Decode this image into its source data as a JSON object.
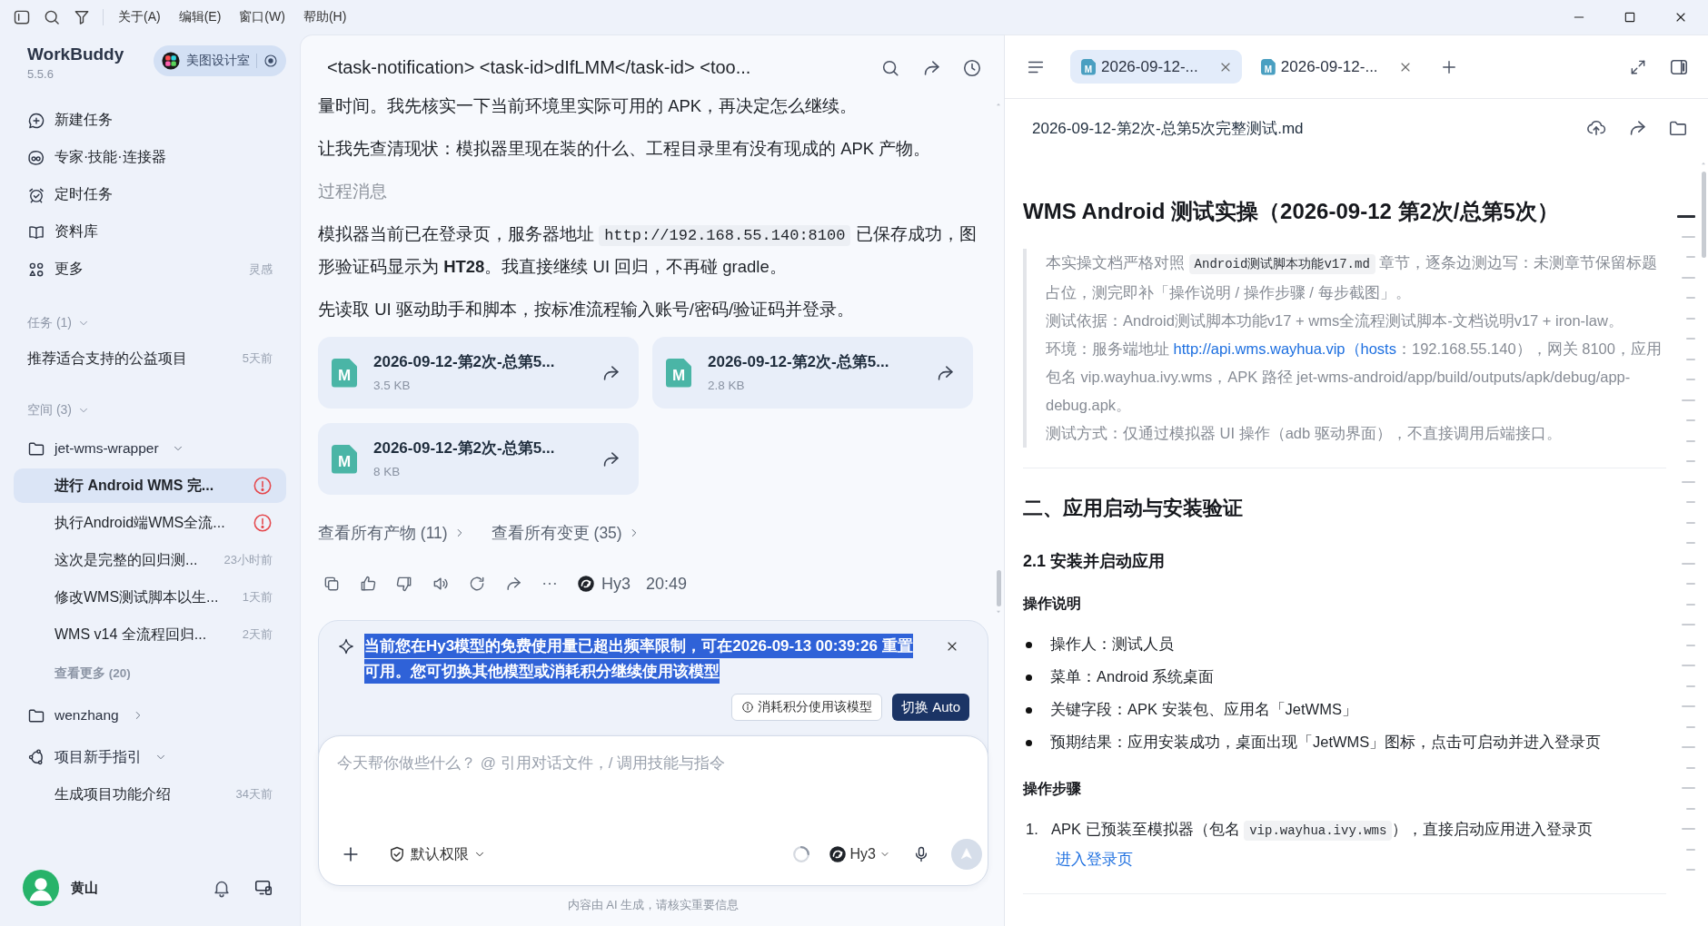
{
  "title_bar": {
    "menu": [
      "关于(A)",
      "编辑(E)",
      "窗口(W)",
      "帮助(H)"
    ]
  },
  "sidebar": {
    "app_name": "WorkBuddy",
    "version": "5.5.6",
    "workspace": "美图设计室",
    "nav": [
      {
        "label": "新建任务"
      },
      {
        "label": "专家·技能·连接器"
      },
      {
        "label": "定时任务"
      },
      {
        "label": "资料库"
      },
      {
        "label": "更多",
        "hint": "灵感"
      }
    ],
    "tasks": {
      "heading": "任务 (1)",
      "expanded": true,
      "items": [
        {
          "title": "推荐适合支持的公益项目",
          "time": "5天前",
          "selected": false,
          "alert": false
        }
      ]
    },
    "spaces": {
      "heading": "空间 (3)",
      "expanded": true,
      "items": [
        {
          "name": "jet-wms-wrapper",
          "kind": "folder",
          "expanded": true,
          "children": [
            {
              "title": "进行 Android WMS 完...",
              "selected": true,
              "alert": true
            },
            {
              "title": "执行Android端WMS全流...",
              "selected": false,
              "alert": true
            },
            {
              "title": "这次是完整的回归测...",
              "time": "23小时前",
              "selected": false,
              "alert": false
            },
            {
              "title": "修改WMS测试脚本以生...",
              "time": "1天前",
              "selected": false,
              "alert": false
            },
            {
              "title": "WMS v14 全流程回归...",
              "time": "2天前",
              "selected": false,
              "alert": false
            }
          ],
          "more": "查看更多 (20)"
        },
        {
          "name": "wenzhang",
          "kind": "folder",
          "expanded": false
        },
        {
          "name": "项目新手指引",
          "kind": "guide",
          "expanded": true,
          "children": [
            {
              "title": "生成项目功能介绍",
              "time": "34天前",
              "selected": false,
              "alert": false
            }
          ]
        }
      ]
    },
    "user": {
      "name": "黄山"
    }
  },
  "chat": {
    "title": "<task-notification> <task-id>dIfLMM</task-id> <too...",
    "messages": [
      {
        "kind": "text",
        "text": "量时间。我先核实一下当前环境里实际可用的 APK，再决定怎么继续。"
      },
      {
        "kind": "text",
        "text": "让我先查清现状：模拟器里现在装的什么、工程目录里有没有现成的 APK 产物。"
      },
      {
        "kind": "label",
        "text": "过程消息"
      },
      {
        "kind": "text",
        "parts": [
          {
            "kind": "text",
            "text": "模拟器当前已在登录页，服务器地址 "
          },
          {
            "kind": "code",
            "text": "http://192.168.55.140:8100"
          },
          {
            "kind": "text",
            "text": " 已保存成功，图形验证码显示为 **HT28**。我直接继续 UI 回归，不再碰 gradle。"
          }
        ]
      },
      {
        "kind": "text",
        "text": "先读取 UI 驱动助手和脚本，按标准流程输入账号/密码/验证码并登录。"
      }
    ],
    "files": [
      {
        "badge": "M",
        "name": "2026-09-12-第2次-总第5...",
        "size": "3.5 KB"
      },
      {
        "badge": "M",
        "name": "2026-09-12-第2次-总第5...",
        "size": "2.8 KB"
      },
      {
        "badge": "M",
        "name": "2026-09-12-第2次-总第5...",
        "size": "8 KB"
      }
    ],
    "links": [
      "查看所有产物 (11)",
      "查看所有变更 (35)"
    ],
    "reply_meta": {
      "model": "Hy3",
      "time": "20:49"
    },
    "notice": {
      "text": "当前您在Hy3模型的免费使用量已超出频率限制，可在2026-09-13 00:39:26 重置可用。您可切换其他模型或消耗积分继续使用该模型",
      "highlighted": true,
      "actions": [
        {
          "label": "消耗积分使用该模型",
          "kind": "secondary"
        },
        {
          "label": "切换 Auto",
          "kind": "primary"
        }
      ]
    },
    "composer": {
      "placeholder": "今天帮你做些什么？ @ 引用对话文件，/ 调用技能与指令",
      "permission": "默认权限",
      "model": "Hy3"
    },
    "disclaimer": "内容由 AI 生成，请核实重要信息"
  },
  "document": {
    "tabs": [
      {
        "badge": "M",
        "label": "2026-09-12-...",
        "selected": true
      },
      {
        "badge": "M",
        "label": "2026-09-12-...",
        "selected": false
      }
    ],
    "file_name": "2026-09-12-第2次-总第5次完整测试.md",
    "blocks": [
      {
        "kind": "h1",
        "text": "WMS Android 测试实操（2026-09-12 第2次/总第5次）"
      },
      {
        "kind": "quote",
        "paragraphs": [
          [
            {
              "kind": "text",
              "text": "本实操文档严格对照 "
            },
            {
              "kind": "code",
              "text": "Android测试脚本功能v17.md"
            },
            {
              "kind": "text",
              "text": " 章节，逐条边测边写：未测章节保留标题占位，测完即补「操作说明 / 操作步骤 / 每步截图」。"
            }
          ],
          [
            {
              "kind": "text",
              "text": "测试依据：Android测试脚本功能v17 + wms全流程测试脚本-文档说明v17 + iron-law。"
            }
          ],
          [
            {
              "kind": "text",
              "text": "环境：服务端地址 "
            },
            {
              "kind": "link",
              "text": "http://api.wms.wayhua.vip（hosts"
            },
            {
              "kind": "text",
              "text": "：192.168.55.140），网关 8100，应用包名 vip.wayhua.ivy.wms，APK 路径 jet-wms-android/app/build/outputs/apk/debug/app-debug.apk。"
            }
          ],
          [
            {
              "kind": "text",
              "text": "测试方式：仅通过模拟器 UI 操作（adb 驱动界面），不直接调用后端接口。"
            }
          ]
        ]
      },
      {
        "kind": "divider"
      },
      {
        "kind": "h2",
        "text": "二、应用启动与安装验证"
      },
      {
        "kind": "h3",
        "text": "2.1 安装并启动应用"
      },
      {
        "kind": "h4",
        "text": "操作说明"
      },
      {
        "kind": "bullets",
        "items": [
          "操作人：测试人员",
          "菜单：Android 系统桌面",
          "关键字段：APK 安装包、应用名「JetWMS」",
          "预期结果：应用安装成功，桌面出现「JetWMS」图标，点击可启动并进入登录页"
        ]
      },
      {
        "kind": "h4",
        "text": "操作步骤"
      },
      {
        "kind": "steps",
        "items": [
          {
            "number": "1.",
            "parts": [
              {
                "kind": "text",
                "text": "APK 已预装至模拟器（包名 "
              },
              {
                "kind": "code",
                "text": "vip.wayhua.ivy.wms"
              },
              {
                "kind": "text",
                "text": "），直接启动应用进入登录页"
              }
            ],
            "link": "进入登录页"
          }
        ]
      },
      {
        "kind": "divider"
      }
    ],
    "outline": [
      {
        "kind": "major",
        "selected": true
      },
      {
        "kind": "major",
        "selected": false
      },
      {
        "kind": "minor",
        "selected": false
      },
      {
        "kind": "major",
        "selected": false
      },
      {
        "kind": "minor",
        "selected": false
      },
      {
        "kind": "minor",
        "selected": false
      },
      {
        "kind": "minor",
        "selected": false
      },
      {
        "kind": "minor",
        "selected": false
      },
      {
        "kind": "minor",
        "selected": false
      },
      {
        "kind": "major",
        "selected": false
      },
      {
        "kind": "minor",
        "selected": false
      },
      {
        "kind": "minor",
        "selected": false
      },
      {
        "kind": "minor",
        "selected": false
      },
      {
        "kind": "major",
        "selected": false
      },
      {
        "kind": "minor",
        "selected": false
      },
      {
        "kind": "minor",
        "selected": false
      },
      {
        "kind": "minor",
        "selected": false
      },
      {
        "kind": "major",
        "selected": false
      },
      {
        "kind": "minor",
        "selected": false
      },
      {
        "kind": "minor",
        "selected": false
      },
      {
        "kind": "major",
        "selected": false
      },
      {
        "kind": "minor",
        "selected": false
      },
      {
        "kind": "major",
        "selected": false
      },
      {
        "kind": "minor",
        "selected": false
      },
      {
        "kind": "major",
        "selected": false
      },
      {
        "kind": "minor",
        "selected": false
      },
      {
        "kind": "major",
        "selected": false
      },
      {
        "kind": "minor",
        "selected": false
      },
      {
        "kind": "major",
        "selected": false
      },
      {
        "kind": "minor",
        "selected": false
      },
      {
        "kind": "major",
        "selected": false
      },
      {
        "kind": "minor",
        "selected": false
      },
      {
        "kind": "minor",
        "selected": false
      }
    ]
  }
}
